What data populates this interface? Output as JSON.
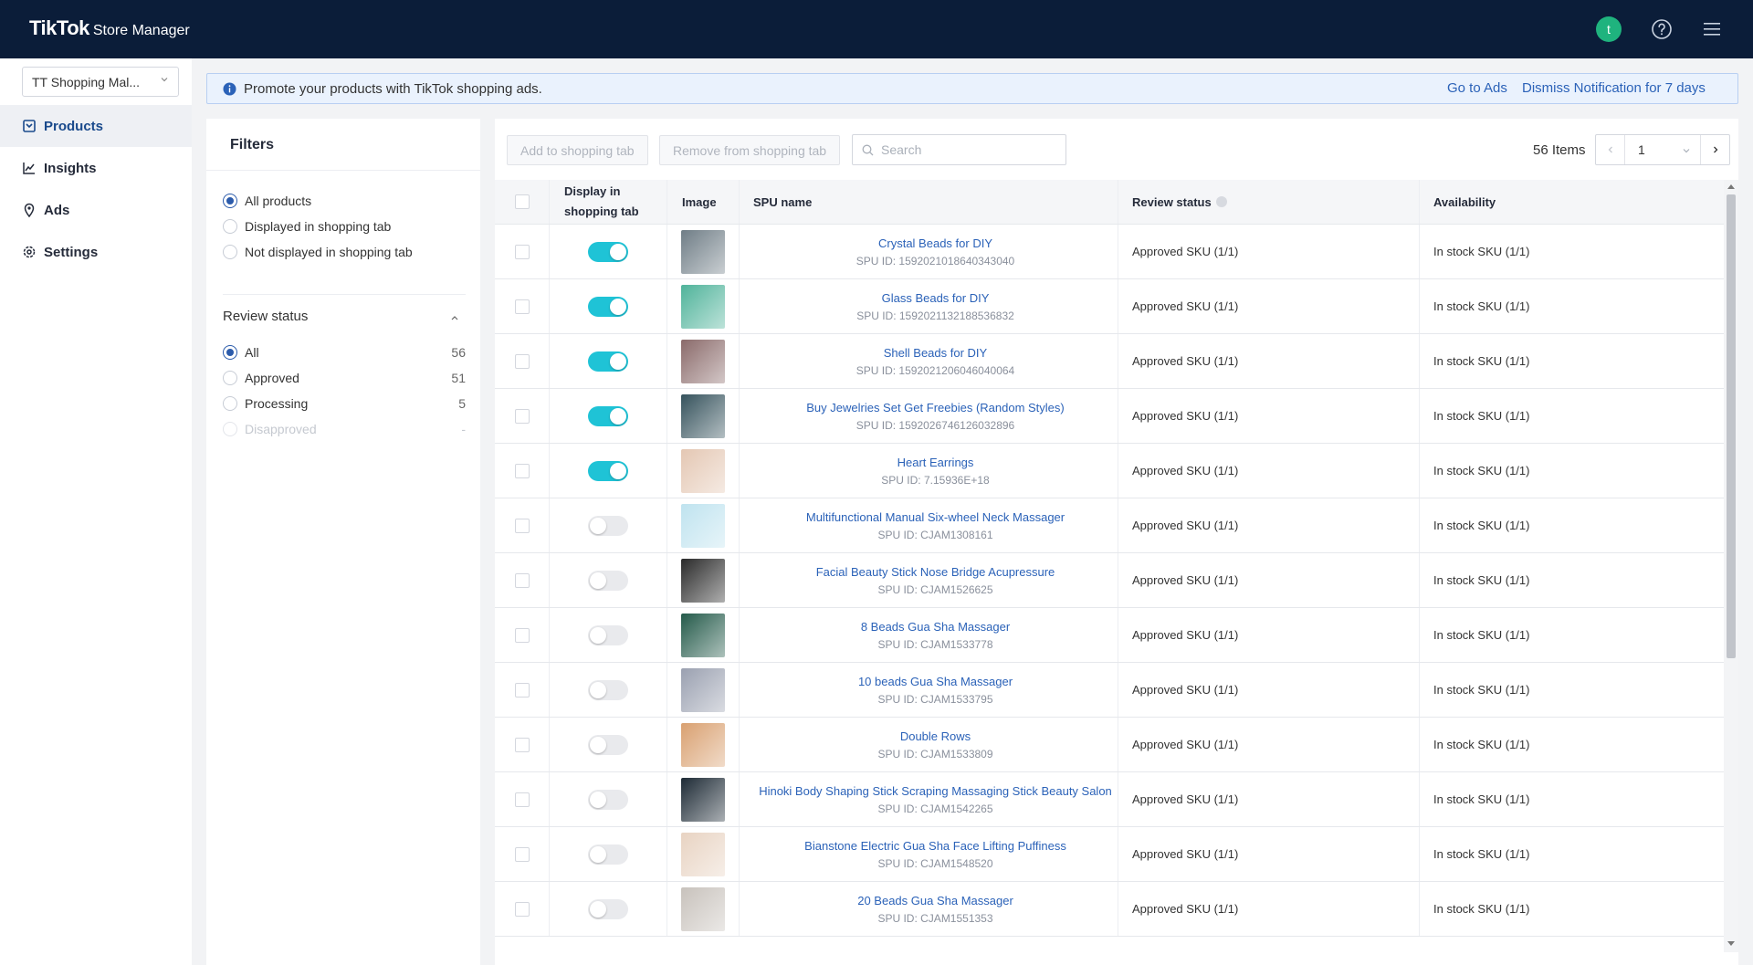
{
  "header": {
    "brand": "TikTok",
    "subtitle": "Store Manager",
    "avatar_initial": "t"
  },
  "sidebar": {
    "shop_select": "TT Shopping Mal...",
    "items": [
      {
        "label": "Products",
        "icon": "products-icon",
        "active": true
      },
      {
        "label": "Insights",
        "icon": "chart-line-icon",
        "active": false
      },
      {
        "label": "Ads",
        "icon": "location-pin-icon",
        "active": false
      },
      {
        "label": "Settings",
        "icon": "gear-icon",
        "active": false
      }
    ]
  },
  "notice": {
    "message": "Promote your products with TikTok shopping ads.",
    "go_to_ads": "Go to Ads",
    "dismiss": "Dismiss Notification for 7 days"
  },
  "filters": {
    "title": "Filters",
    "display_options": [
      {
        "label": "All products",
        "selected": true
      },
      {
        "label": "Displayed in shopping tab",
        "selected": false
      },
      {
        "label": "Not displayed in shopping tab",
        "selected": false
      }
    ],
    "review_status_title": "Review status",
    "review_options": [
      {
        "label": "All",
        "count": "56",
        "selected": true,
        "disabled": false
      },
      {
        "label": "Approved",
        "count": "51",
        "selected": false,
        "disabled": false
      },
      {
        "label": "Processing",
        "count": "5",
        "selected": false,
        "disabled": false
      },
      {
        "label": "Disapproved",
        "count": "-",
        "selected": false,
        "disabled": true
      }
    ]
  },
  "toolbar": {
    "add_label": "Add to shopping tab",
    "remove_label": "Remove from shopping tab",
    "search_placeholder": "Search",
    "items_count": "56 Items",
    "page": "1"
  },
  "table": {
    "headers": {
      "display_line1": "Display in",
      "display_line2": "shopping tab",
      "image": "Image",
      "spu_name": "SPU name",
      "review_status": "Review status",
      "availability": "Availability"
    },
    "rows": [
      {
        "name": "Crystal Beads for DIY",
        "spu": "SPU ID: 1592021018640343040",
        "review": "Approved SKU (1/1)",
        "availability": "In stock SKU (1/1)",
        "displayed": true,
        "thumb": "#6f7d86"
      },
      {
        "name": "Glass Beads for DIY",
        "spu": "SPU ID: 1592021132188536832",
        "review": "Approved SKU (1/1)",
        "availability": "In stock SKU (1/1)",
        "displayed": true,
        "thumb": "#4fb39a"
      },
      {
        "name": "Shell Beads for DIY",
        "spu": "SPU ID: 1592021206046040064",
        "review": "Approved SKU (1/1)",
        "availability": "In stock SKU (1/1)",
        "displayed": true,
        "thumb": "#8a6a6a"
      },
      {
        "name": "Buy Jewelries Set Get Freebies (Random Styles)",
        "spu": "SPU ID: 1592026746126032896",
        "review": "Approved SKU (1/1)",
        "availability": "In stock SKU (1/1)",
        "displayed": true,
        "thumb": "#35525c"
      },
      {
        "name": "Heart Earrings",
        "spu": "SPU ID: 7.15936E+18",
        "review": "Approved SKU (1/1)",
        "availability": "In stock SKU (1/1)",
        "displayed": true,
        "thumb": "#e4c7b3"
      },
      {
        "name": "Multifunctional Manual Six-wheel Neck Massager",
        "spu": "SPU ID: CJAM1308161",
        "review": "Approved SKU (1/1)",
        "availability": "In stock SKU (1/1)",
        "displayed": false,
        "thumb": "#bfe3ef"
      },
      {
        "name": "Facial Beauty Stick Nose Bridge Acupressure",
        "spu": "SPU ID: CJAM1526625",
        "review": "Approved SKU (1/1)",
        "availability": "In stock SKU (1/1)",
        "displayed": false,
        "thumb": "#2a2a2a"
      },
      {
        "name": "8 Beads Gua Sha Massager",
        "spu": "SPU ID: CJAM1533778",
        "review": "Approved SKU (1/1)",
        "availability": "In stock SKU (1/1)",
        "displayed": false,
        "thumb": "#245a4a"
      },
      {
        "name": "10 beads Gua Sha Massager",
        "spu": "SPU ID: CJAM1533795",
        "review": "Approved SKU (1/1)",
        "availability": "In stock SKU (1/1)",
        "displayed": false,
        "thumb": "#9aa0b0"
      },
      {
        "name": "Double Rows",
        "spu": "SPU ID: CJAM1533809",
        "review": "Approved SKU (1/1)",
        "availability": "In stock SKU (1/1)",
        "displayed": false,
        "thumb": "#d9a070"
      },
      {
        "name": "Hinoki Body Shaping Stick Scraping Massaging Stick Beauty Salon",
        "spu": "SPU ID: CJAM1542265",
        "review": "Approved SKU (1/1)",
        "availability": "In stock SKU (1/1)",
        "displayed": false,
        "thumb": "#1d2a35"
      },
      {
        "name": "Bianstone Electric Gua Sha Face Lifting Puffiness",
        "spu": "SPU ID: CJAM1548520",
        "review": "Approved SKU (1/1)",
        "availability": "In stock SKU (1/1)",
        "displayed": false,
        "thumb": "#e8d3c2"
      },
      {
        "name": "20 Beads Gua Sha Massager",
        "spu": "SPU ID: CJAM1551353",
        "review": "Approved SKU (1/1)",
        "availability": "In stock SKU (1/1)",
        "displayed": false,
        "thumb": "#c8c2bc"
      }
    ]
  },
  "colors": {
    "header_bg": "#0b1d39",
    "accent": "#2b62b8",
    "toggle_on": "#1fc3d6",
    "avatar": "#1fb37e"
  }
}
